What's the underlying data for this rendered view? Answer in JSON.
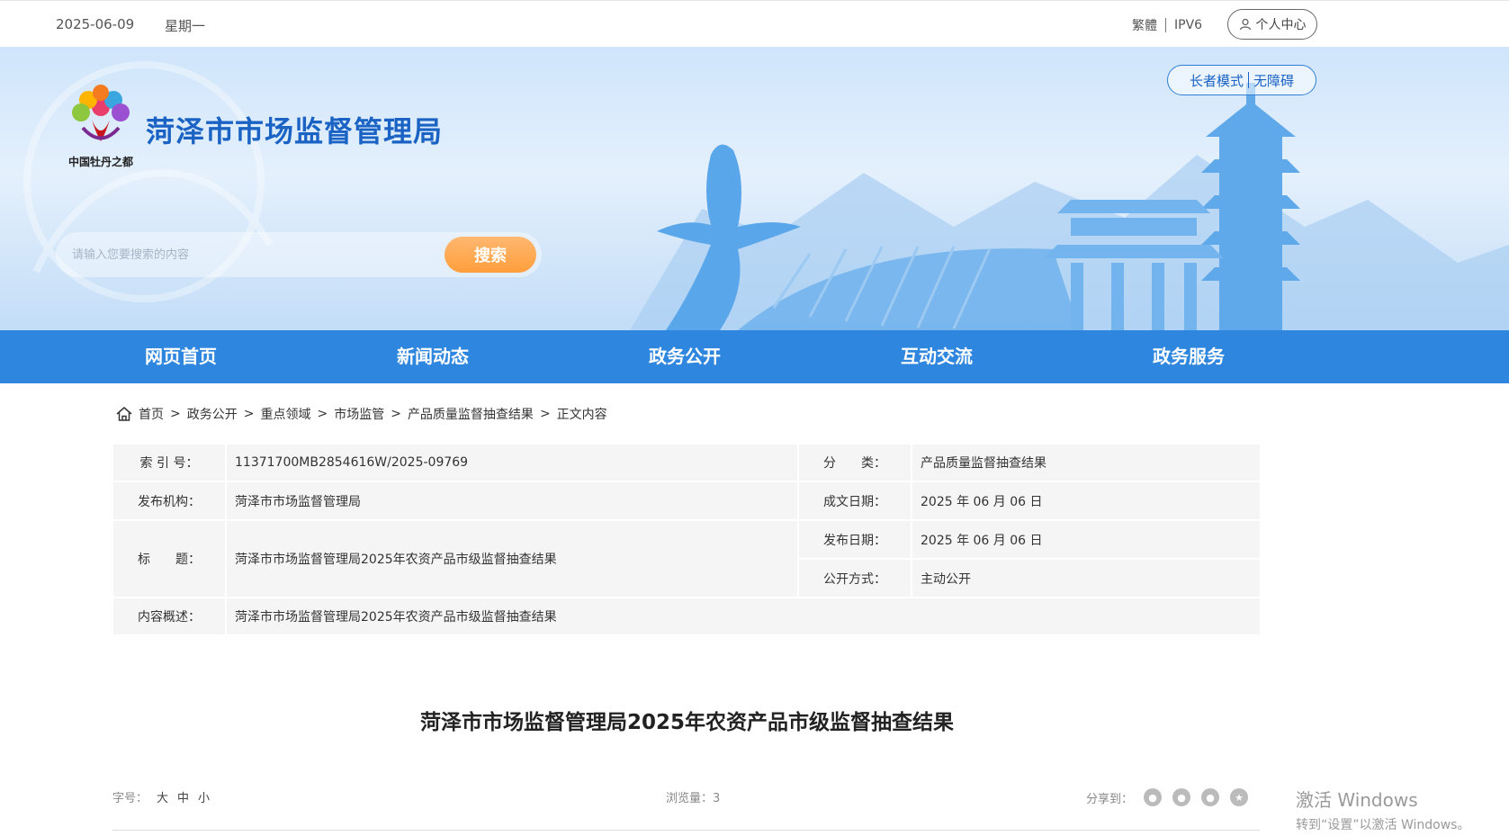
{
  "topbar": {
    "date": "2025-06-09",
    "weekday": "星期一",
    "traditional": "繁體",
    "ipv6": "IPV6",
    "user_center": "个人中心"
  },
  "header": {
    "title": "菏泽市市场监督管理局",
    "elder_mode": "长者模式",
    "accessible": "无障碍",
    "logo_text": "中国牡丹之都",
    "search": {
      "placeholder": "请输入您要搜索的内容",
      "button": "搜索"
    }
  },
  "nav": {
    "items": [
      "网页首页",
      "新闻动态",
      "政务公开",
      "互动交流",
      "政务服务"
    ]
  },
  "breadcrumb": [
    "首页",
    "政务公开",
    "重点领域",
    "市场监管",
    "产品质量监督抽查结果",
    "正文内容"
  ],
  "breadcrumb_separator": ">",
  "info": {
    "index_label": "索 引 号：",
    "index_value": "11371700MB2854616W/2025-09769",
    "category_label": "分　　类：",
    "category_value": "产品质量监督抽查结果",
    "publisher_label": "发布机构：",
    "publisher_value": "菏泽市市场监督管理局",
    "created_label": "成文日期：",
    "created_value": "2025 年 06 月 06 日",
    "title_label": "标　　题：",
    "title_value": "菏泽市市场监督管理局2025年农资产品市级监督抽查结果",
    "published_label": "发布日期：",
    "published_value": "2025 年 06 月 06 日",
    "open_label": "公开方式：",
    "open_value": "主动公开",
    "summary_label": "内容概述：",
    "summary_value": "菏泽市市场监督管理局2025年农资产品市级监督抽查结果"
  },
  "article": {
    "title": "菏泽市市场监督管理局2025年农资产品市级监督抽查结果",
    "font_size_label": "字号：",
    "font_large": "大",
    "font_medium": "中",
    "font_small": "小",
    "views": "浏览量：3",
    "share_label": "分享到："
  },
  "watermark": {
    "line1": "激活 Windows",
    "line2": "转到“设置”以激活 Windows。"
  },
  "colors": {
    "nav": "#2e86de",
    "title": "#1a63c4",
    "search_button": "#ff9e3c"
  }
}
